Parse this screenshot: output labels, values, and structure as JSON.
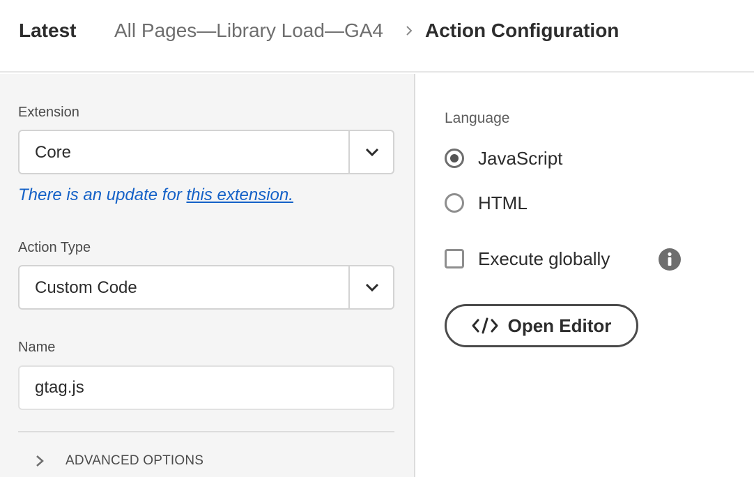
{
  "header": {
    "latest": "Latest",
    "breadcrumb_parent": "All Pages—Library Load—GA4",
    "breadcrumb_current": "Action Configuration"
  },
  "left": {
    "extension": {
      "label": "Extension",
      "value": "Core",
      "update_note_prefix": "There is an update for ",
      "update_note_link": "this extension."
    },
    "action_type": {
      "label": "Action Type",
      "value": "Custom Code"
    },
    "name": {
      "label": "Name",
      "value": "gtag.js"
    },
    "advanced_label": "ADVANCED OPTIONS"
  },
  "right": {
    "language_label": "Language",
    "options": [
      {
        "label": "JavaScript",
        "selected": true
      },
      {
        "label": "HTML",
        "selected": false
      }
    ],
    "execute_globally": {
      "label": "Execute globally",
      "checked": false
    },
    "open_editor_label": "Open Editor"
  },
  "icons": {
    "breadcrumb_separator": "chevron-right-icon",
    "select_toggle": "chevron-down-icon",
    "advanced_toggle": "chevron-right-icon",
    "info": "info-icon",
    "code": "code-icon"
  },
  "colors": {
    "link": "#1461c7",
    "panel_bg": "#f5f5f5",
    "text": "#2c2c2c"
  }
}
